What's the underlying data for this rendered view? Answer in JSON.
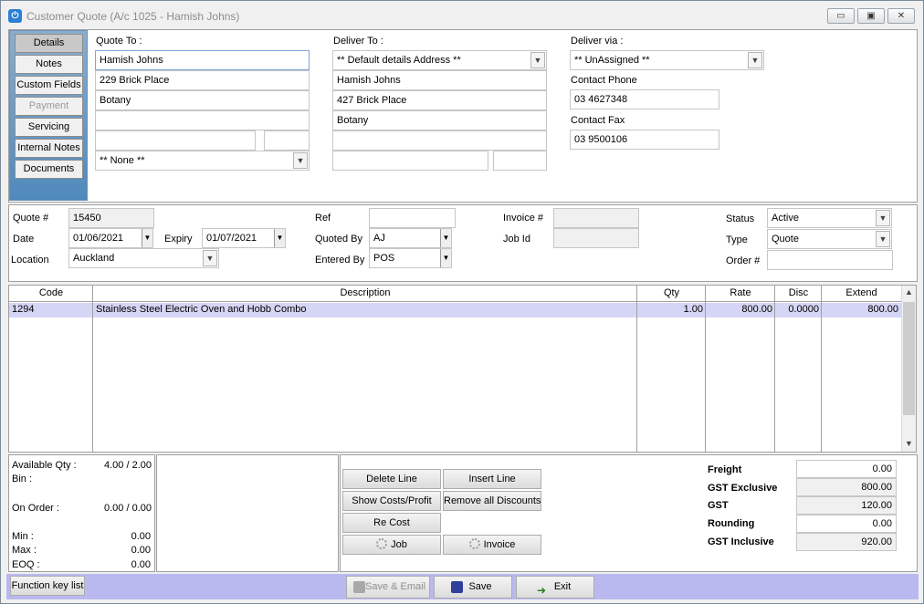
{
  "window": {
    "title": "Customer Quote (A/c 1025 - Hamish Johns)",
    "app_icon_glyph": "⏻",
    "minimize_glyph": "▭",
    "maximize_glyph": "▣",
    "close_glyph": "✕"
  },
  "side_tabs": [
    {
      "label": "Details"
    },
    {
      "label": "Notes"
    },
    {
      "label": "Custom Fields"
    },
    {
      "label": "Payment"
    },
    {
      "label": "Servicing"
    },
    {
      "label": "Internal Notes"
    },
    {
      "label": "Documents"
    }
  ],
  "quote_to": {
    "label": "Quote To :",
    "line1": "Hamish Johns",
    "line2": "229 Brick Place",
    "line3": "Botany",
    "line4": "",
    "line5a": "",
    "line5b": "",
    "region": "** None **"
  },
  "deliver_to": {
    "label": "Deliver To :",
    "address_select": "** Default details Address **",
    "line1": "Hamish Johns",
    "line2": "427 Brick Place",
    "line3": "Botany",
    "line4": "",
    "line5a": "",
    "line5b": ""
  },
  "deliver_via": {
    "label": "Deliver via :",
    "value": "** UnAssigned **",
    "contact_phone_label": "Contact Phone",
    "contact_phone": "03 4627348",
    "contact_fax_label": "Contact Fax",
    "contact_fax": "03 9500106"
  },
  "header": {
    "quote_no_label": "Quote #",
    "quote_no": "15450",
    "date_label": "Date",
    "date": "01/06/2021",
    "expiry_label": "Expiry",
    "expiry": "01/07/2021",
    "location_label": "Location",
    "location": "Auckland",
    "ref_label": "Ref",
    "ref": "",
    "quoted_by_label": "Quoted By",
    "quoted_by": "AJ",
    "entered_by_label": "Entered By",
    "entered_by": "POS",
    "invoice_label": "Invoice #",
    "invoice": "",
    "job_id_label": "Job Id",
    "job_id": "",
    "status_label": "Status",
    "status": "Active",
    "type_label": "Type",
    "type": "Quote",
    "order_label": "Order #",
    "order": ""
  },
  "lines": {
    "columns": [
      "Code",
      "Description",
      "Qty",
      "Rate",
      "Disc",
      "Extend"
    ],
    "rows": [
      {
        "code": "1294",
        "description": "Stainless Steel Electric Oven and Hobb Combo",
        "qty": "1.00",
        "rate": "800.00",
        "disc": "0.0000",
        "extend": "800.00"
      }
    ]
  },
  "stock": {
    "available_label": "Available Qty :",
    "available": "4.00 / 2.00",
    "bin_label": "Bin :",
    "bin": "",
    "on_order_label": "On Order :",
    "on_order": "0.00 / 0.00",
    "min_label": "Min :",
    "min": "0.00",
    "max_label": "Max :",
    "max": "0.00",
    "eoq_label": "EOQ :",
    "eoq": "0.00"
  },
  "actions": {
    "delete_line": "Delete Line",
    "insert_line": "Insert Line",
    "show_costs": "Show Costs/Profit",
    "remove_discounts": "Remove all Discounts",
    "re_cost": "Re Cost",
    "job": "Job",
    "invoice": "Invoice"
  },
  "totals": {
    "freight_label": "Freight",
    "freight": "0.00",
    "gst_excl_label": "GST Exclusive",
    "gst_excl": "800.00",
    "gst_label": "GST",
    "gst": "120.00",
    "rounding_label": "Rounding",
    "rounding": "0.00",
    "gst_incl_label": "GST Inclusive",
    "gst_incl": "920.00"
  },
  "footer": {
    "function_key_list": "Function key list",
    "save_email": "Save & Email",
    "save": "Save",
    "exit": "Exit"
  },
  "colors": {
    "side_tab_bg": "#4f89bb",
    "grid_row_highlight": "#d5d5f5",
    "bottom_bar": "#b9b9f0"
  }
}
